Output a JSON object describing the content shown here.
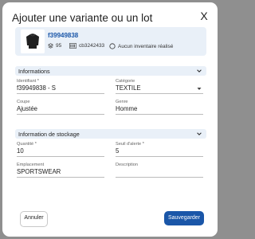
{
  "dialog": {
    "title": "Ajouter une variante ou un lot",
    "close_label": "X"
  },
  "product": {
    "sku": "f39949838",
    "stock_count": "95",
    "code": "cb3242433",
    "inventory_status": "Aucun inventaire réalisé"
  },
  "sections": {
    "informations": "Informations",
    "stockage": "Information de stockage"
  },
  "fields": {
    "identifiant": {
      "label": "Identifiant *",
      "value": "f39949838 - S"
    },
    "categorie": {
      "label": "Catégorie",
      "value": "TEXTILE"
    },
    "coupe": {
      "label": "Coupe",
      "value": "Ajustée"
    },
    "genre": {
      "label": "Genre",
      "value": "Homme"
    },
    "quantite": {
      "label": "Quantité *",
      "value": "10"
    },
    "seuil": {
      "label": "Seuil d'alerte *",
      "value": "5"
    },
    "emplacement": {
      "label": "Emplacement",
      "value": "SPORTSWEAR"
    },
    "description": {
      "label": "Description",
      "value": ""
    }
  },
  "buttons": {
    "cancel": "Annuler",
    "save": "Sauvegarder"
  },
  "colors": {
    "accent": "#1a56a8",
    "section_bg": "#e9f0f8",
    "overlay": "#8f8f8f"
  }
}
